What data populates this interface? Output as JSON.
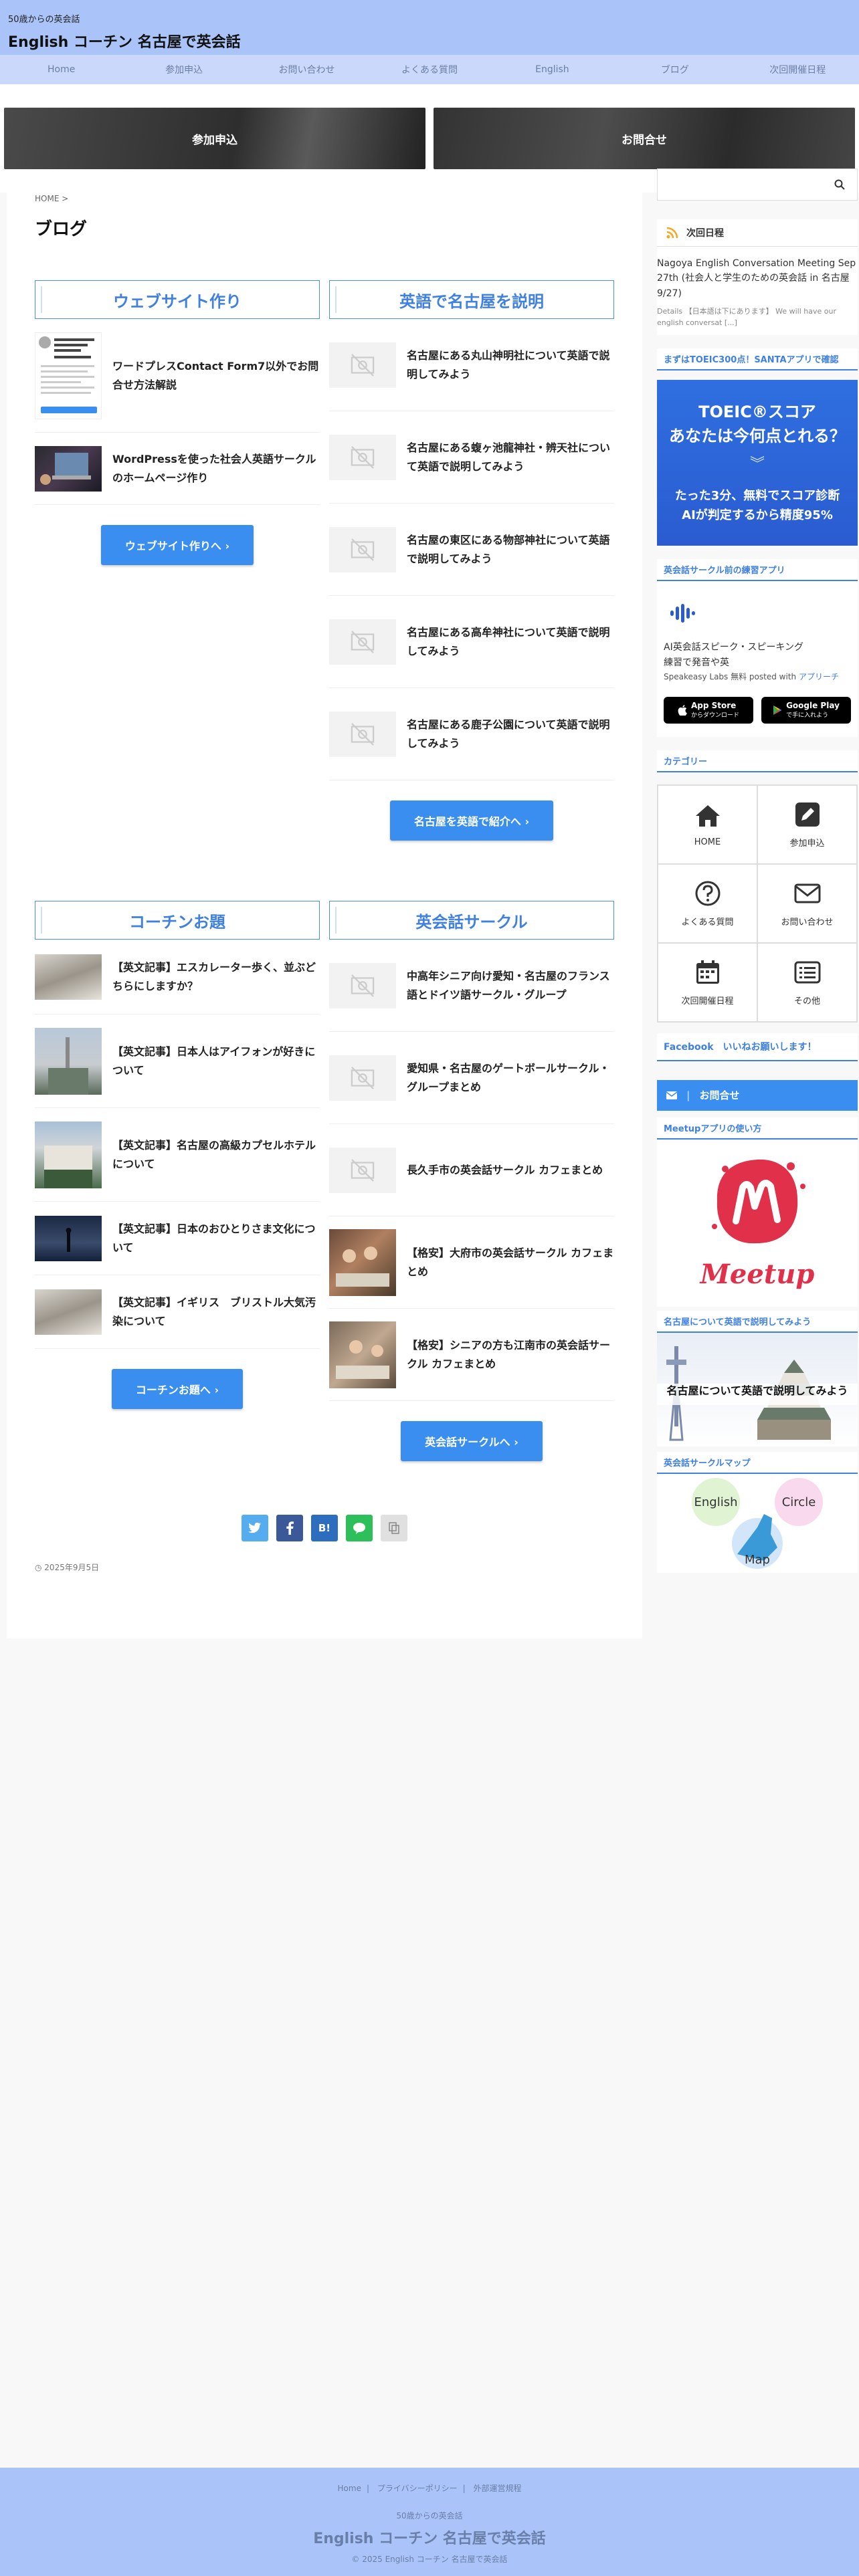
{
  "header": {
    "subtitle": "50歳からの英会話",
    "title": "English コーチン 名古屋で英会話"
  },
  "nav": [
    "Home",
    "参加申込",
    "お問い合わせ",
    "よくある質問",
    "English",
    "ブログ",
    "次回開催日程"
  ],
  "band": {
    "join": "参加申込",
    "contact": "お問合せ"
  },
  "breadcrumb": "HOME >",
  "page_title": "ブログ",
  "sections": {
    "website": {
      "heading": "ウェブサイト作り",
      "items": [
        "ワードプレスContact Form7以外でお問合せ方法解説",
        "WordPressを使った社会人英語サークルのホームページ作り"
      ],
      "more": "ウェブサイト作りへ ›"
    },
    "nagoya": {
      "heading": "英語で名古屋を説明",
      "items": [
        "名古屋にある丸山神明社について英語で説明してみよう",
        "名古屋にある蝮ヶ池龍神社・辨天社について英語で説明してみよう",
        "名古屋の東区にある物部神社について英語で説明してみよう",
        "名古屋にある高牟神社について英語で説明してみよう",
        "名古屋にある鹿子公園について英語で説明してみよう"
      ],
      "more": "名古屋を英語で紹介へ ›"
    },
    "coachin": {
      "heading": "コーチンお題",
      "items": [
        "【英文記事】エスカレーター歩く、並ぶどちらにしますか？",
        "【英文記事】日本人はアイフォンが好きについて",
        "【英文記事】名古屋の高級カプセルホテルについて",
        "【英文記事】日本のおひとりさま文化について",
        "【英文記事】イギリス　ブリストル大気汚染について"
      ],
      "more": "コーチンお題へ ›"
    },
    "circle": {
      "heading": "英会話サークル",
      "items": [
        "中高年シニア向け愛知・名古屋のフランス語とドイツ語サークル・グループ",
        "愛知県・名古屋のゲートボールサークル・グループまとめ",
        "長久手市の英会話サークル カフェまとめ",
        "【格安】大府市の英会話サークル カフェまとめ",
        "【格安】シニアの方も江南市の英会話サークル カフェまとめ"
      ],
      "more": "英会話サークルへ ›"
    }
  },
  "share": {
    "hatena": "B!"
  },
  "post_date": "2025年9月5日",
  "sidebar": {
    "rss_title": "次回日程",
    "event_title": "Nagoya English Conversation Meeting Sep 27th (社会人と学生のための英会話 in 名古屋 9/27)",
    "event_detail": "Details 【日本語は下にあります】 We will have our english conversat [...]",
    "toeic_title": "まずはTOEIC300点！SANTAアプリで確認",
    "promo_line1": "TOEIC®スコア",
    "promo_line2": "あなたは今何点とれる？",
    "promo_line3": "たった3分、無料でスコア診断",
    "promo_line4": "AIが判定するから精度95%",
    "app_widget_title": "英会話サークル前の練習アプリ",
    "app_name": "AI英会話スピーク・スピーキング練習で発音や英",
    "app_meta": "Speakeasy Labs 無料 posted with",
    "app_link": "アプリーチ",
    "appstore": "App Store",
    "appstore_sub": "からダウンロード",
    "googleplay": "Google Play",
    "googleplay_sub": "で手に入れよう",
    "category_title": "カテゴリー",
    "categories": [
      "HOME",
      "参加申込",
      "よくある質問",
      "お問い合わせ",
      "次回開催日程",
      "その他"
    ],
    "facebook": "Facebook　いいねお願いします！",
    "contact": "お問合せ",
    "meetup_title": "Meetupアプリの使い方",
    "meetup_logo": "Meetup",
    "nagoya_title": "名古屋について英語で説明してみよう",
    "nagoya_banner": "名古屋について英語で説明してみよう",
    "map_title": "英会話サークルマップ",
    "map_words": [
      "English",
      "Circle",
      "Map"
    ]
  },
  "footer": {
    "links": [
      "Home",
      "プライバシーポリシー",
      "外部運営規程"
    ],
    "subtitle": "50歳からの英会話",
    "title": "English コーチン 名古屋で英会話",
    "copy": "© 2025 English コーチン 名古屋で英会話"
  },
  "colors": {
    "accent": "#3a8ef0",
    "header": "#aac3f8",
    "nav": "#c9d8fb"
  }
}
